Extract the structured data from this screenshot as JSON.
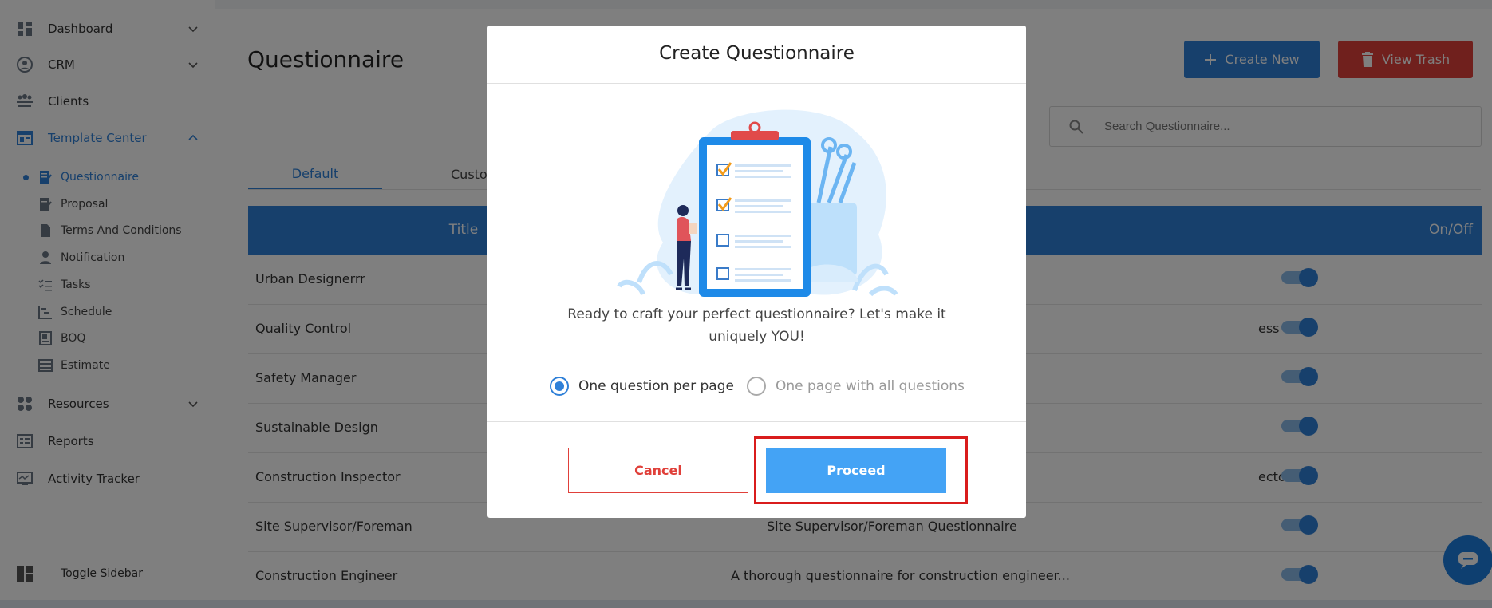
{
  "sidebar": {
    "items": [
      {
        "label": "Dashboard",
        "icon": "dashboard-icon"
      },
      {
        "label": "CRM",
        "icon": "crm-icon"
      },
      {
        "label": "Clients",
        "icon": "clients-icon"
      },
      {
        "label": "Template Center",
        "icon": "template-icon"
      },
      {
        "label": "Resources",
        "icon": "resources-icon"
      },
      {
        "label": "Reports",
        "icon": "reports-icon"
      },
      {
        "label": "Activity Tracker",
        "icon": "activity-icon"
      }
    ],
    "subitems": [
      {
        "label": "Questionnaire"
      },
      {
        "label": "Proposal"
      },
      {
        "label": "Terms And Conditions"
      },
      {
        "label": "Notification"
      },
      {
        "label": "Tasks"
      },
      {
        "label": "Schedule"
      },
      {
        "label": "BOQ"
      },
      {
        "label": "Estimate"
      }
    ],
    "toggle_label": "Toggle Sidebar"
  },
  "page": {
    "title": "Questionnaire",
    "create_label": "Create New",
    "trash_label": "View Trash",
    "search_placeholder": "Search Questionnaire...",
    "tabs": [
      "Default",
      "Custo"
    ],
    "columns": {
      "title": "Title",
      "onoff": "On/Off"
    },
    "rows": [
      {
        "title": "Urban Designerrr",
        "desc": ""
      },
      {
        "title": "Quality Control",
        "desc": "ess a..."
      },
      {
        "title": "Safety Manager",
        "desc": ""
      },
      {
        "title": "Sustainable Design",
        "desc": ""
      },
      {
        "title": "Construction Inspector",
        "desc": "ecto..."
      },
      {
        "title": "Site Supervisor/Foreman",
        "desc": "Site Supervisor/Foreman Questionnaire"
      },
      {
        "title": "Construction Engineer",
        "desc": "A thorough questionnaire for construction engineer..."
      }
    ]
  },
  "modal": {
    "title": "Create Questionnaire",
    "message": "Ready to craft your perfect questionnaire? Let's make it uniquely YOU!",
    "option_one": "One question per page",
    "option_two": "One page with all questions",
    "cancel_label": "Cancel",
    "proceed_label": "Proceed"
  },
  "colors": {
    "accent": "#2f80d8",
    "danger": "#e0403a",
    "proceed": "#44a3f5"
  }
}
